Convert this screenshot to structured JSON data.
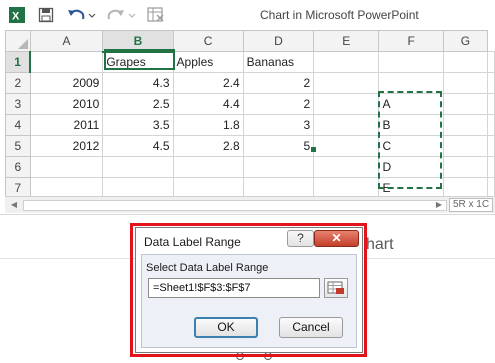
{
  "window": {
    "title": "Chart in Microsoft PowerPoint"
  },
  "toolbar": {
    "icons": [
      "excel-icon",
      "save-icon",
      "undo-icon",
      "redo-icon",
      "embedded-sheet-icon"
    ]
  },
  "sheet": {
    "columns": [
      "A",
      "B",
      "C",
      "D",
      "E",
      "F",
      "G"
    ],
    "selected_column": "B",
    "rows": [
      {
        "num": "1",
        "cells": [
          "",
          "Grapes",
          "Apples",
          "Bananas",
          "",
          "",
          ""
        ]
      },
      {
        "num": "2",
        "cells": [
          "2009",
          "4.3",
          "2.4",
          "2",
          "",
          "",
          ""
        ]
      },
      {
        "num": "3",
        "cells": [
          "2010",
          "2.5",
          "4.4",
          "2",
          "",
          "A",
          ""
        ]
      },
      {
        "num": "4",
        "cells": [
          "2011",
          "3.5",
          "1.8",
          "3",
          "",
          "B",
          ""
        ]
      },
      {
        "num": "5",
        "cells": [
          "2012",
          "4.5",
          "2.8",
          "5",
          "",
          "C",
          ""
        ]
      },
      {
        "num": "6",
        "cells": [
          "",
          "",
          "",
          "",
          "",
          "D",
          ""
        ]
      },
      {
        "num": "7",
        "cells": [
          "",
          "",
          "",
          "",
          "",
          "E",
          ""
        ]
      }
    ],
    "selection_size": "5R x 1C"
  },
  "slide": {
    "chart_title_fragment": "hart"
  },
  "dialog": {
    "title": "Data Label Range",
    "help_label": "?",
    "close_label": "✕",
    "field_label": "Select Data Label Range",
    "field_value": "=Sheet1!$F$3:$F$7",
    "ok_label": "OK",
    "cancel_label": "Cancel"
  },
  "colors": {
    "excel_green": "#217346",
    "highlight_red": "#e3131c",
    "close_red": "#c3402b"
  }
}
